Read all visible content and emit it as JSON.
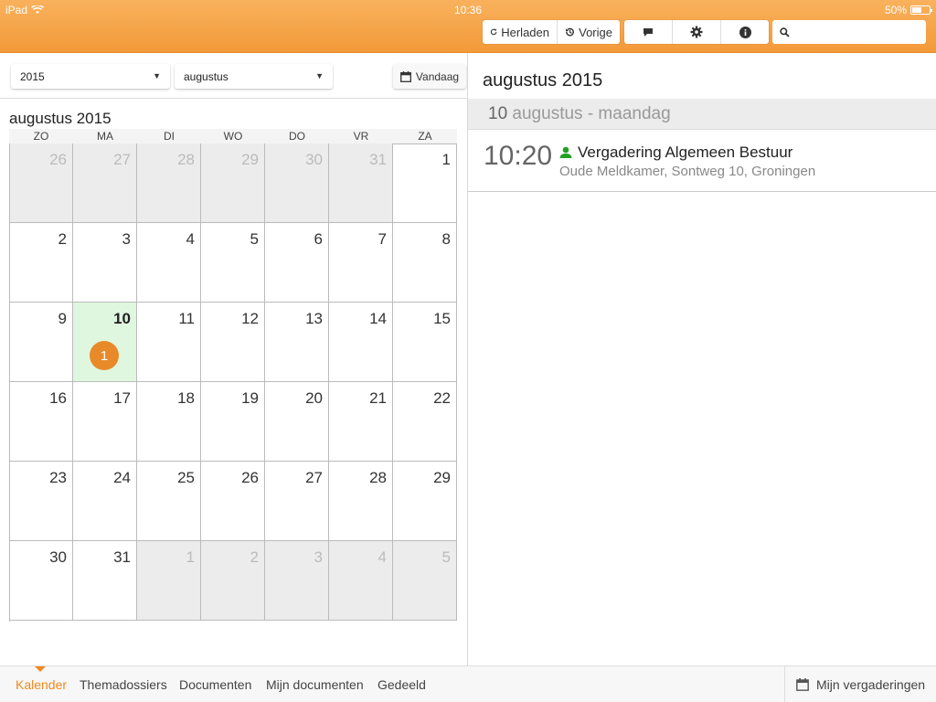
{
  "status": {
    "carrier": "iPad",
    "time": "10:36",
    "battery": "50%"
  },
  "toolbar": {
    "reload_label": "Herladen",
    "previous_label": "Vorige",
    "search_placeholder": ""
  },
  "filters": {
    "year_value": "2015",
    "month_value": "augustus",
    "today_label": "Vandaag"
  },
  "calendar": {
    "title": "augustus 2015",
    "weekdays": [
      "ZO",
      "MA",
      "DI",
      "WO",
      "DO",
      "VR",
      "ZA"
    ],
    "weeks": [
      [
        {
          "d": "26",
          "other": true
        },
        {
          "d": "27",
          "other": true
        },
        {
          "d": "28",
          "other": true
        },
        {
          "d": "29",
          "other": true
        },
        {
          "d": "30",
          "other": true
        },
        {
          "d": "31",
          "other": true
        },
        {
          "d": "1"
        }
      ],
      [
        {
          "d": "2"
        },
        {
          "d": "3"
        },
        {
          "d": "4"
        },
        {
          "d": "5"
        },
        {
          "d": "6"
        },
        {
          "d": "7"
        },
        {
          "d": "8"
        }
      ],
      [
        {
          "d": "9"
        },
        {
          "d": "10",
          "today": true,
          "badge": "1"
        },
        {
          "d": "11"
        },
        {
          "d": "12"
        },
        {
          "d": "13"
        },
        {
          "d": "14"
        },
        {
          "d": "15"
        }
      ],
      [
        {
          "d": "16"
        },
        {
          "d": "17"
        },
        {
          "d": "18"
        },
        {
          "d": "19"
        },
        {
          "d": "20"
        },
        {
          "d": "21"
        },
        {
          "d": "22"
        }
      ],
      [
        {
          "d": "23"
        },
        {
          "d": "24"
        },
        {
          "d": "25"
        },
        {
          "d": "26"
        },
        {
          "d": "27"
        },
        {
          "d": "28"
        },
        {
          "d": "29"
        }
      ],
      [
        {
          "d": "30"
        },
        {
          "d": "31"
        },
        {
          "d": "1",
          "other": true
        },
        {
          "d": "2",
          "other": true
        },
        {
          "d": "3",
          "other": true
        },
        {
          "d": "4",
          "other": true
        },
        {
          "d": "5",
          "other": true
        }
      ]
    ]
  },
  "detail": {
    "title": "augustus 2015",
    "day_number": "10",
    "day_text": "augustus - maandag",
    "events": [
      {
        "time": "10:20",
        "title": "Vergadering Algemeen Bestuur",
        "location": "Oude Meldkamer, Sontweg 10, Groningen"
      }
    ]
  },
  "tabs": {
    "kalender": "Kalender",
    "themadossiers": "Themadossiers",
    "documenten": "Documenten",
    "mijn_documenten": "Mijn documenten",
    "gedeeld": "Gedeeld",
    "mijn_vergaderingen": "Mijn vergaderingen"
  },
  "colors": {
    "accent": "#f39a3a",
    "today_bg": "#dff7df",
    "badge": "#e88a2a",
    "attendee_icon": "#22a022"
  }
}
